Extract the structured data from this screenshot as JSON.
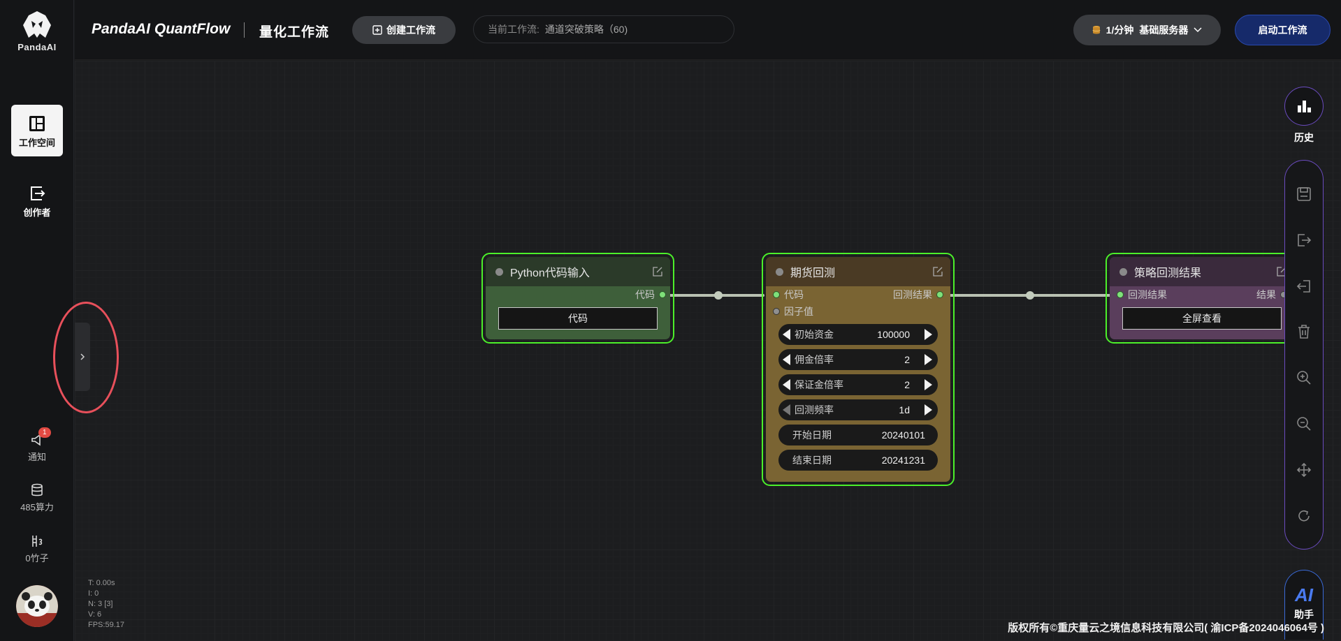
{
  "brand": {
    "name": "PandaAI",
    "title": "PandaAI QuantFlow",
    "subtitle": "量化工作流"
  },
  "header": {
    "create_label": "创建工作流",
    "current_prefix": "当前工作流:",
    "current_value": "通道突破策略（60)",
    "server_rate": "1/分钟",
    "server_name": "基础服务器",
    "start_label": "启动工作流"
  },
  "sidebar": {
    "items": [
      {
        "label": "工作空间"
      },
      {
        "label": "创作者"
      }
    ],
    "notify_label": "通知",
    "notify_count": "1",
    "compute_label": "485算力",
    "bamboo_label": "0竹子"
  },
  "nodes": {
    "python": {
      "title": "Python代码输入",
      "out_port": "代码",
      "button": "代码"
    },
    "backtest": {
      "title": "期货回测",
      "in_ports": [
        "代码",
        "因子值"
      ],
      "out_port": "回测结果",
      "params": [
        {
          "name": "初始资金",
          "value": "100000"
        },
        {
          "name": "佣金倍率",
          "value": "2"
        },
        {
          "name": "保证金倍率",
          "value": "2"
        },
        {
          "name": "回测频率",
          "value": "1d"
        },
        {
          "name": "开始日期",
          "value": "20240101"
        },
        {
          "name": "结束日期",
          "value": "20241231"
        }
      ]
    },
    "result": {
      "title": "策略回测结果",
      "in_port": "回测结果",
      "out_port": "结果",
      "button": "全屏查看"
    }
  },
  "toolbar": {
    "history_label": "历史",
    "ai_text": "AI",
    "ai_label": "助手"
  },
  "stats": {
    "t": "T: 0.00s",
    "i": "I: 0",
    "n": "N: 3 [3]",
    "v": "V: 6",
    "fps": "FPS:59.17"
  },
  "footer": "版权所有©重庆量云之境信息科技有限公司( 渝ICP备2024046064号 )",
  "colors": {
    "node_border": "#4cf02a",
    "python_bg": "#3e5f3a",
    "backtest_bg": "#7a6433",
    "result_bg": "#5a3e5c",
    "accent_purple": "#6a4bbf"
  }
}
